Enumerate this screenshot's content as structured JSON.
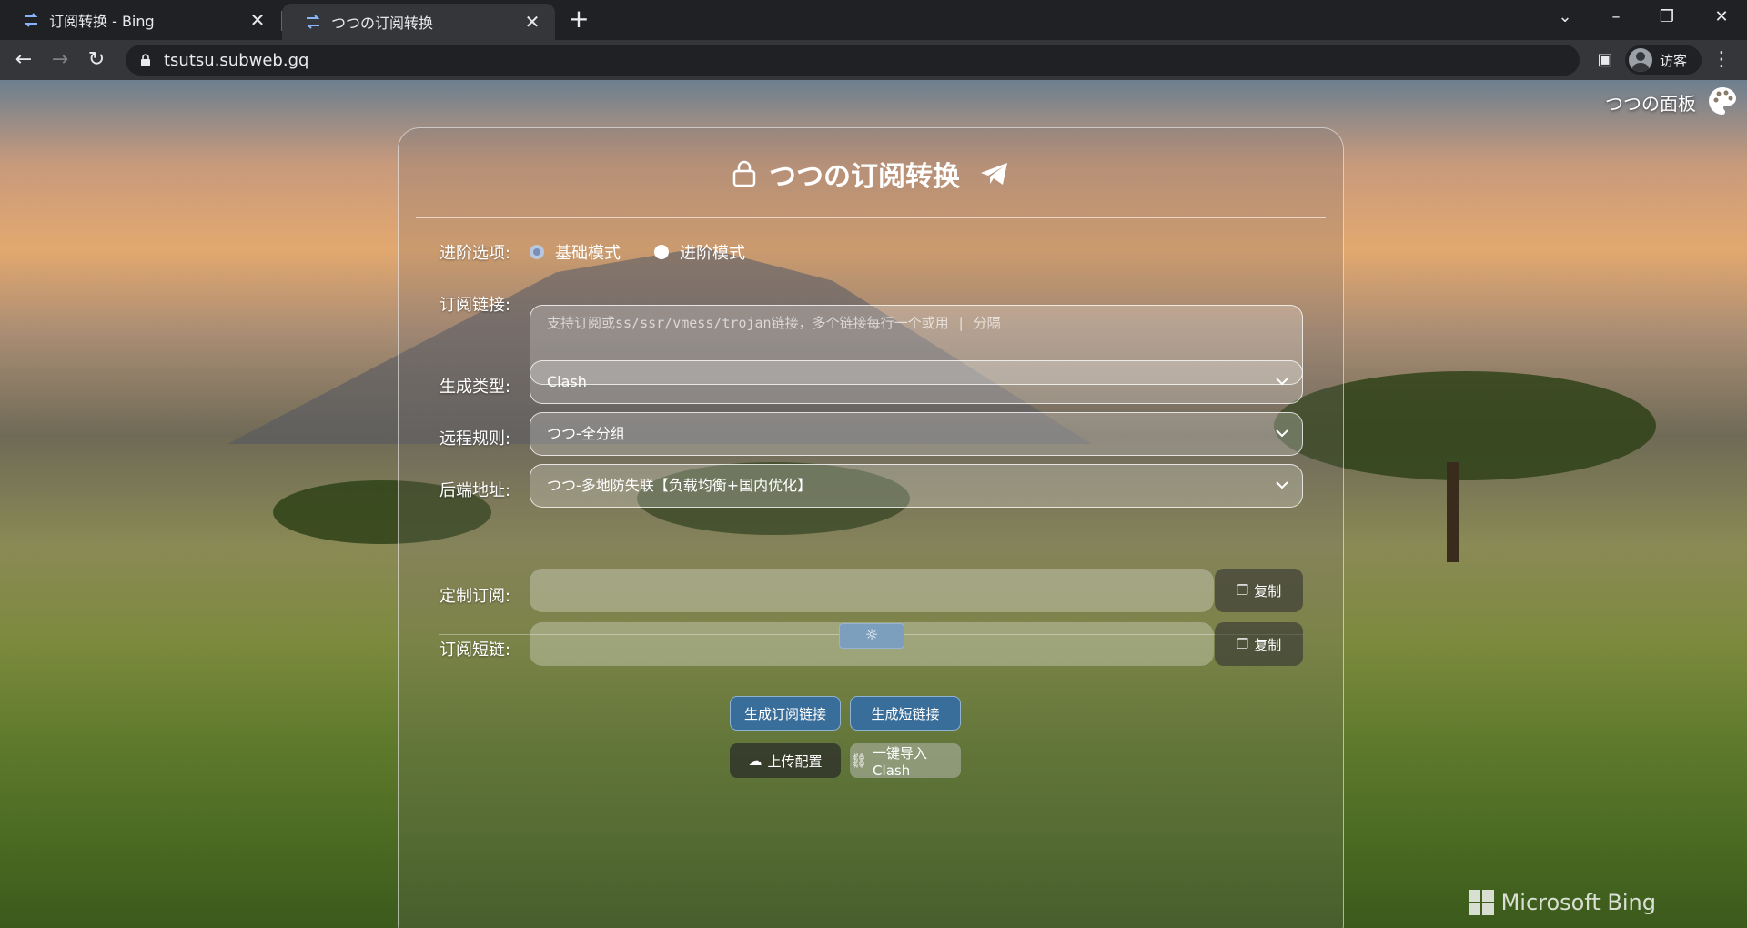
{
  "browser": {
    "tabs": [
      {
        "title": "订阅转换 - Bing",
        "active": false
      },
      {
        "title": "つつの订阅转换",
        "active": true
      }
    ],
    "url": "tsutsu.subweb.gq",
    "profile_label": "访客"
  },
  "page": {
    "panel_link": "つつの面板",
    "card_title": "つつの订阅转换",
    "advanced": {
      "label": "进阶选项:",
      "options": [
        {
          "label": "基础模式",
          "selected": true
        },
        {
          "label": "进阶模式",
          "selected": false
        }
      ]
    },
    "subscription": {
      "label": "订阅链接:",
      "placeholder": "支持订阅或ss/ssr/vmess/trojan链接，多个链接每行一个或用 | 分隔",
      "value": ""
    },
    "target_type": {
      "label": "生成类型:",
      "value": "Clash"
    },
    "remote_rules": {
      "label": "远程规则:",
      "value": "つつ-全分组"
    },
    "backend": {
      "label": "后端地址:",
      "value": "つつ-多地防失联【负载均衡+国内优化】"
    },
    "custom_sub": {
      "label": "定制订阅:",
      "value": "",
      "copy_label": "复制"
    },
    "short_link": {
      "label": "订阅短链:",
      "value": "",
      "copy_label": "复制"
    },
    "buttons": {
      "generate_sub": "生成订阅链接",
      "generate_short": "生成短链接",
      "upload_config": "上传配置",
      "import_clash": "一键导入Clash"
    },
    "watermark": "Microsoft Bing",
    "colors": {
      "primary_button": "#3a6e9a",
      "spinner_button": "#4c7aa6"
    }
  }
}
